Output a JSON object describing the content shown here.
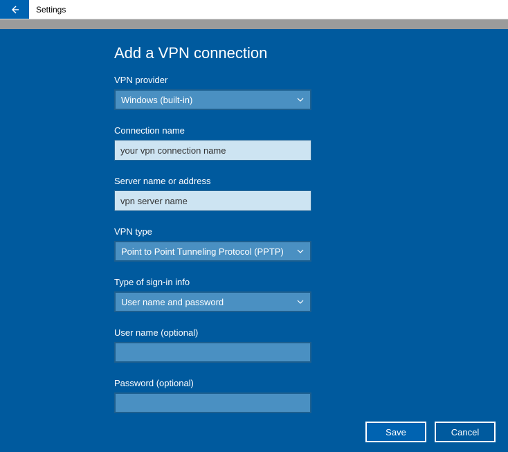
{
  "window": {
    "title": "Settings"
  },
  "page": {
    "heading": "Add a VPN connection"
  },
  "fields": {
    "provider": {
      "label": "VPN provider",
      "value": "Windows (built-in)"
    },
    "connectionName": {
      "label": "Connection name",
      "value": "your vpn connection name"
    },
    "serverName": {
      "label": "Server name or address",
      "value": "vpn server name"
    },
    "vpnType": {
      "label": "VPN type",
      "value": "Point to Point Tunneling Protocol (PPTP)"
    },
    "signinType": {
      "label": "Type of sign-in info",
      "value": "User name and password"
    },
    "username": {
      "label": "User name (optional)",
      "value": ""
    },
    "password": {
      "label": "Password (optional)",
      "value": ""
    }
  },
  "buttons": {
    "save": "Save",
    "cancel": "Cancel"
  }
}
